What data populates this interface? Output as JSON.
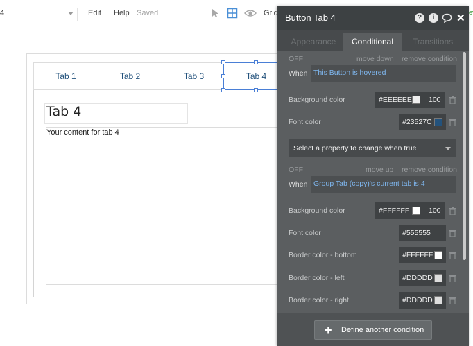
{
  "toolbar": {
    "page_name": "4",
    "menu_edit": "Edit",
    "menu_help": "Help",
    "saved_status": "Saved",
    "grid_label": "Grid",
    "cut_off_text": "ev",
    "icons": [
      "cursor-arrow-icon",
      "grid-layout-icon",
      "eye-icon"
    ]
  },
  "canvas": {
    "tabs": [
      {
        "label": "Tab 1"
      },
      {
        "label": "Tab 2"
      },
      {
        "label": "Tab 3"
      },
      {
        "label": "Tab 4"
      }
    ],
    "selected_tab": "Tab 4",
    "content_title": "Tab 4",
    "content_body": "Your content for tab 4"
  },
  "panel": {
    "title": "Button Tab 4",
    "header_icons": [
      "help-icon",
      "info-icon",
      "comment-icon",
      "close-icon"
    ],
    "tabs": [
      "Appearance",
      "Conditional",
      "Transitions"
    ],
    "active_tab": "Conditional",
    "conditions": [
      {
        "state": "OFF",
        "move_action": "move down",
        "remove_action": "remove condition",
        "when_label": "When",
        "expression": "This Button is hovered",
        "properties": [
          {
            "label": "Background color",
            "color": "#EEEEEE",
            "swatch": "#EEEEEE",
            "opacity": "100"
          },
          {
            "label": "Font color",
            "color": "#23527C",
            "swatch": "#23527C"
          }
        ],
        "select_placeholder": "Select a property to change when true"
      },
      {
        "state": "OFF",
        "move_action": "move up",
        "remove_action": "remove condition",
        "when_label": "When",
        "expression": "Group Tab (copy)'s current tab is 4",
        "properties": [
          {
            "label": "Background color",
            "color": "#FFFFFF",
            "swatch": "#FFFFFF",
            "opacity": "100"
          },
          {
            "label": "Font color",
            "color": "#555555"
          },
          {
            "label": "Border color - bottom",
            "color": "#FFFFFF",
            "swatch": "#FFFFFF"
          },
          {
            "label": "Border color - left",
            "color": "#DDDDD",
            "swatch": "#DDDDDD"
          },
          {
            "label": "Border color - right",
            "color": "#DDDDD",
            "swatch": "#DDDDDD"
          }
        ]
      }
    ],
    "define_button": "Define another condition"
  },
  "colors": {
    "panel_bg": "#5B5E60",
    "panel_header": "#3D4143",
    "expression_text": "#7FB7EF",
    "tab_text": "#23527C",
    "selection": "#4A7FD6"
  }
}
